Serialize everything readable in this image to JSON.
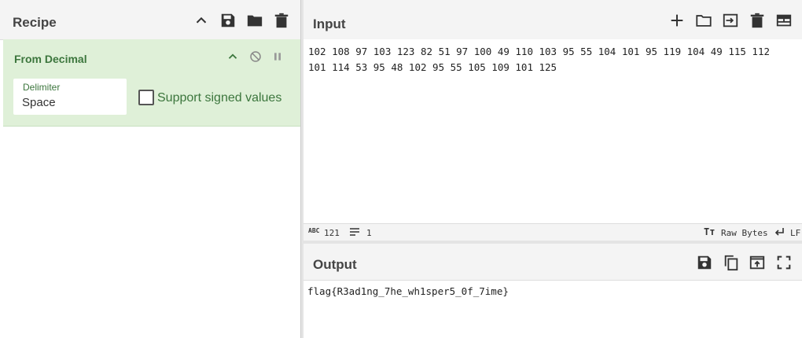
{
  "recipe": {
    "title": "Recipe",
    "icons": [
      "chevron-up-icon",
      "save-icon",
      "folder-icon",
      "trash-icon"
    ],
    "operation": {
      "name": "From Decimal",
      "icons": [
        "chevron-up-icon",
        "disable-icon",
        "pause-icon"
      ],
      "delimiter_label": "Delimiter",
      "delimiter_value": "Space",
      "signed_label": "Support signed values",
      "signed_checked": false
    }
  },
  "input": {
    "title": "Input",
    "icons": [
      "plus-icon",
      "folder-icon",
      "import-icon",
      "trash-icon",
      "layout-icon"
    ],
    "text": "102 108 97 103 123 82 51 97 100 49 110 103 95 55 104 101 95 119 104 49 115 112 101 114 53 95 48 102 95 55 105 109 101 125",
    "status": {
      "length": "121",
      "lines": "1",
      "encoding": "Raw Bytes",
      "eol": "LF"
    }
  },
  "output": {
    "title": "Output",
    "icons": [
      "save-icon",
      "copy-icon",
      "replace-input-icon",
      "fullscreen-icon"
    ],
    "text": "flag{R3ad1ng_7he_wh1sper5_0f_7ime}"
  },
  "colors": {
    "accent_green": "#3c763d",
    "operation_bg": "#dff0d8",
    "header_bg": "#f4f4f4"
  }
}
